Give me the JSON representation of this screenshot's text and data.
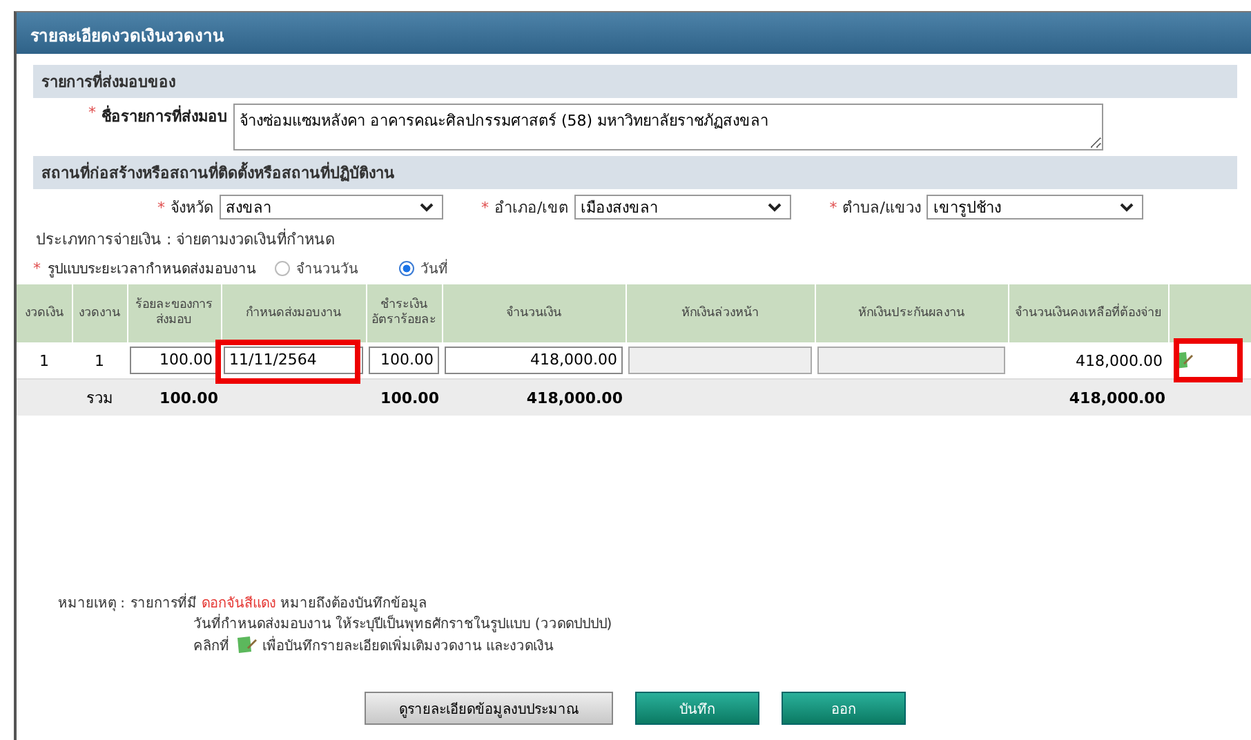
{
  "window": {
    "title": "รายละเอียดงวดเงินงวดงาน"
  },
  "delivery_section": {
    "heading": "รายการที่ส่งมอบของ",
    "required_mark": "*",
    "label": "ชื่อรายการที่ส่งมอบ",
    "value": "จ้างซ่อมแซมหลังคา อาคารคณะศิลปกรรมศาสตร์ (58) มหาวิทยาลัยราชภัฏสงขลา"
  },
  "location_section": {
    "heading": "สถานที่ก่อสร้างหรือสถานที่ติดตั้งหรือสถานที่ปฏิบัติงาน",
    "selects": [
      {
        "required_mark": "*",
        "label": "จังหวัด",
        "value": "สงขลา"
      },
      {
        "required_mark": "*",
        "label": "อำเภอ/เขต",
        "value": "เมืองสงขลา"
      },
      {
        "required_mark": "*",
        "label": "ตำบล/แขวง",
        "value": "เขารูปช้าง"
      }
    ],
    "payment_type": "ประเภทการจ่ายเงิน : จ่ายตามงวดเงินที่กำหนด",
    "period": {
      "required_mark": "*",
      "label": "รูปแบบระยะเวลากำหนดส่งมอบงาน",
      "options": [
        {
          "label": "จำนวนวัน",
          "selected": false
        },
        {
          "label": "วันที่",
          "selected": true
        }
      ]
    }
  },
  "table": {
    "columns": [
      "งวดเงิน",
      "งวดงาน",
      "ร้อยละของการส่งมอบ",
      "กำหนดส่งมอบงาน",
      "ชำระเงินอัตราร้อยละ",
      "จำนวนเงิน",
      "หักเงินล่วงหน้า",
      "หักเงินประกันผลงาน",
      "จำนวนเงินคงเหลือที่ต้องจ่าย"
    ],
    "rows": [
      {
        "money_period": "1",
        "work_period": "1",
        "percent": "100.00",
        "due_date": "11/11/2564",
        "pay_rate": "100.00",
        "amount": "418,000.00",
        "advance": "",
        "guarantee": "",
        "remaining": "418,000.00",
        "date_highlighted": true,
        "action_highlighted": true
      }
    ],
    "total": {
      "label": "รวม",
      "percent": "100.00",
      "pay_rate": "100.00",
      "amount": "418,000.00",
      "remaining": "418,000.00"
    }
  },
  "notes": {
    "label": "หมายเหตุ :",
    "line1_before": "รายการที่มี",
    "line1_red": "ดอกจันสีแดง",
    "line1_after": "หมายถึงต้องบันทึกข้อมูล",
    "line2": "วันที่กำหนดส่งมอบงาน ให้ระบุปีเป็นพุทธศักราชในรูปแบบ (ววดดปปปป)",
    "line3_before": "คลิกที่",
    "line3_after": "เพื่อบันทึกรายละเอียดเพิ่มเติมงวดงาน และงวดเงิน"
  },
  "buttons": [
    {
      "label": "ดูรายละเอียดข้อมูลงบประมาณ",
      "kind": "secondary"
    },
    {
      "label": "บันทึก",
      "kind": "primary"
    },
    {
      "label": "ออก",
      "kind": "primary"
    }
  ]
}
